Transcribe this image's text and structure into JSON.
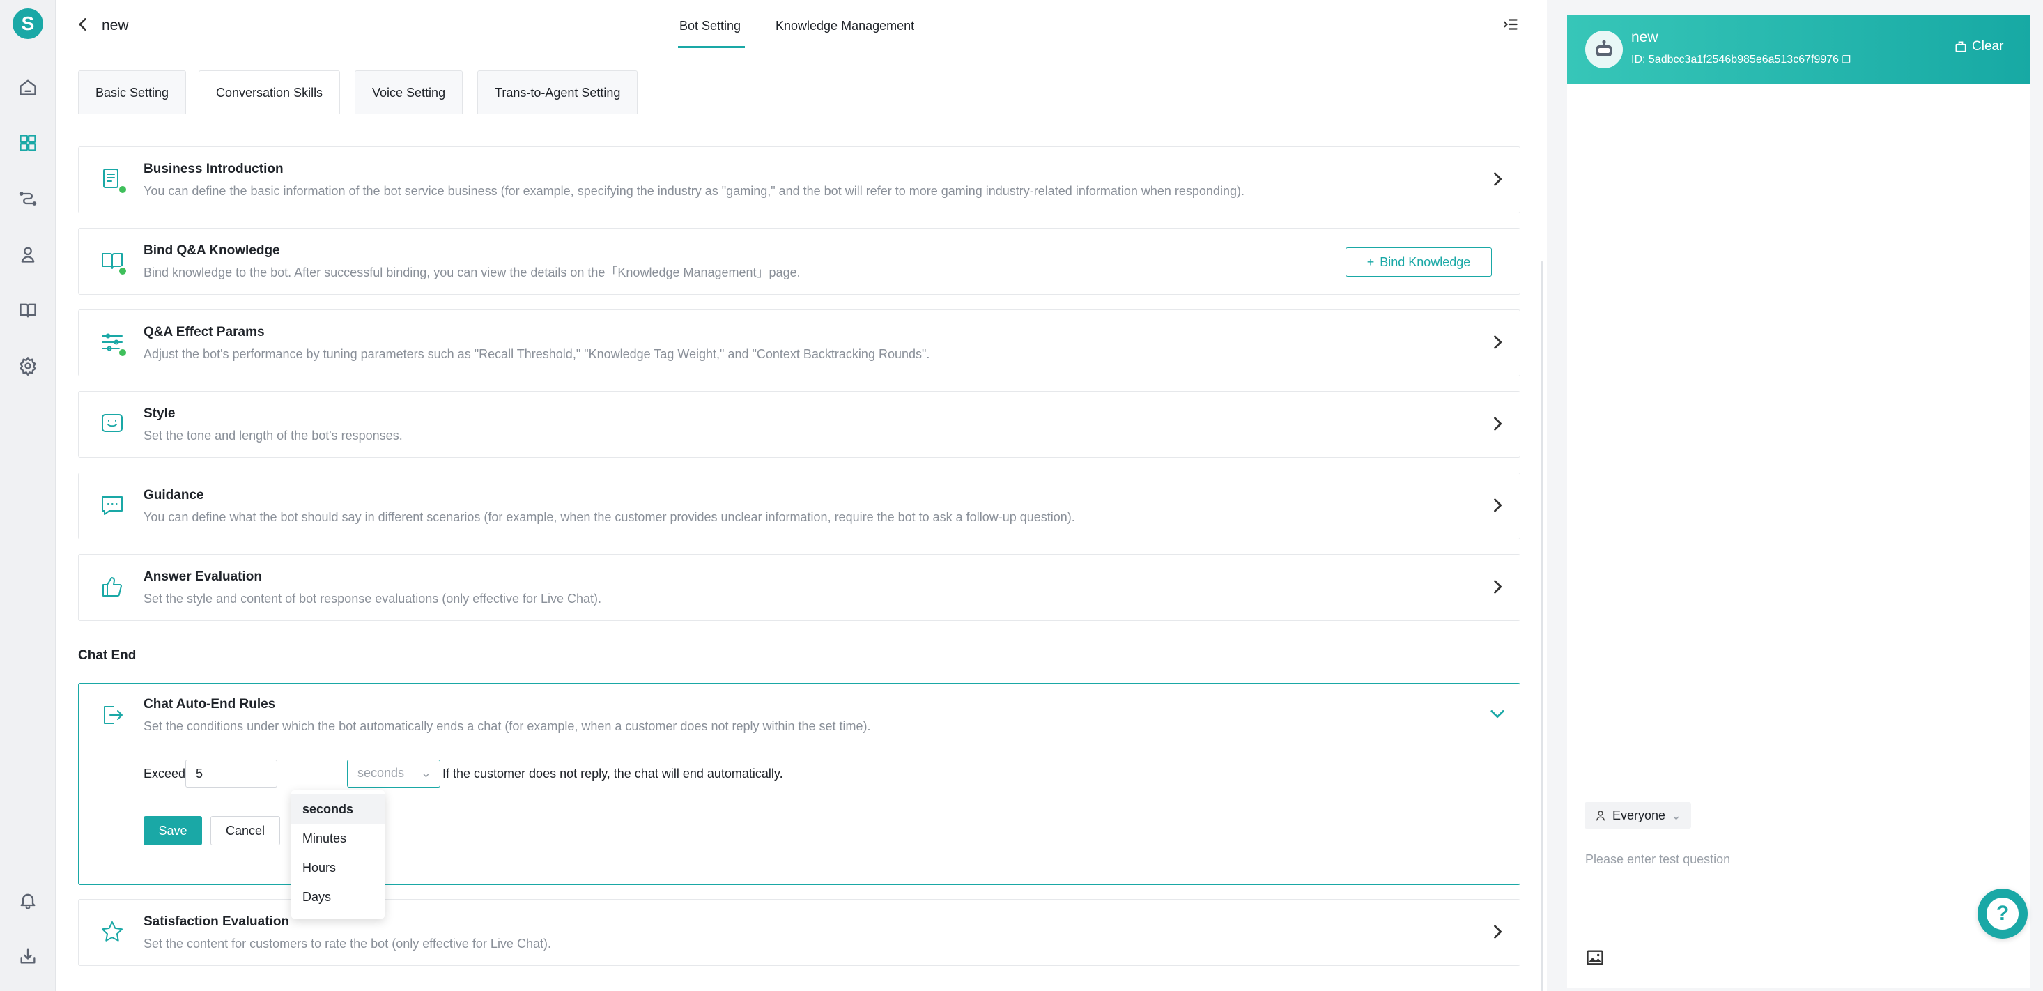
{
  "app": {
    "logo_letter": "S",
    "accent": "#1aa8a6"
  },
  "header": {
    "bot_name": "new",
    "tabs": [
      "Bot Setting",
      "Knowledge Management"
    ]
  },
  "subtabs": [
    "Basic Setting",
    "Conversation Skills",
    "Voice Setting",
    "Trans-to-Agent Setting"
  ],
  "cards": [
    {
      "title": "Business Introduction",
      "desc": "You can define the basic information of the bot service business (for example, specifying the industry as \"gaming,\" and the bot will refer to more gaming industry-related information when responding).",
      "icon": "document-icon",
      "status": "enabled-check"
    },
    {
      "title": "Bind Q&A Knowledge",
      "desc": "Bind knowledge to the bot. After successful binding, you can view the details on the「Knowledge Management」page.",
      "icon": "book-icon",
      "status": "enabled-check",
      "button": "Bind Knowledge"
    },
    {
      "title": "Q&A Effect Params",
      "desc": "Adjust the bot's performance by tuning parameters such as \"Recall Threshold,\" \"Knowledge Tag Weight,\" and \"Context Backtracking Rounds\".",
      "icon": "sliders-icon",
      "status": "enabled-check"
    },
    {
      "title": "Style",
      "desc": "Set the tone and length of the bot's responses.",
      "icon": "smile-icon"
    },
    {
      "title": "Guidance",
      "desc": "You can define what the bot should say in different scenarios (for example, when the customer provides unclear information, require the bot to ask a follow-up question).",
      "icon": "chat-bubble-icon"
    },
    {
      "title": "Answer Evaluation",
      "desc": "Set the style and content of bot response evaluations (only effective for Live Chat).",
      "icon": "thumbs-up-icon"
    }
  ],
  "chat_end": {
    "section_title": "Chat End",
    "auto_end": {
      "title": "Chat Auto-End Rules",
      "desc": "Set the conditions under which the bot automatically ends a chat (for example, when a customer does not reply within the set time).",
      "exceed_label": "Exceed",
      "exceed_value": "5",
      "unit_selected": "seconds",
      "unit_options": [
        "seconds",
        "Minutes",
        "Hours",
        "Days"
      ],
      "suffix": "If the customer does not reply, the chat will end automatically.",
      "save_label": "Save",
      "cancel_label": "Cancel"
    },
    "satisfaction": {
      "title": "Satisfaction Evaluation",
      "desc": "Set the content for customers to rate the bot (only effective for Live Chat)."
    }
  },
  "chat_panel": {
    "name": "new",
    "id_text": "ID: 5adbcc3a1f2546b985e6a513c67f9976",
    "clear_label": "Clear",
    "audience": "Everyone",
    "input_placeholder": "Please enter test question",
    "help_label": "?"
  }
}
